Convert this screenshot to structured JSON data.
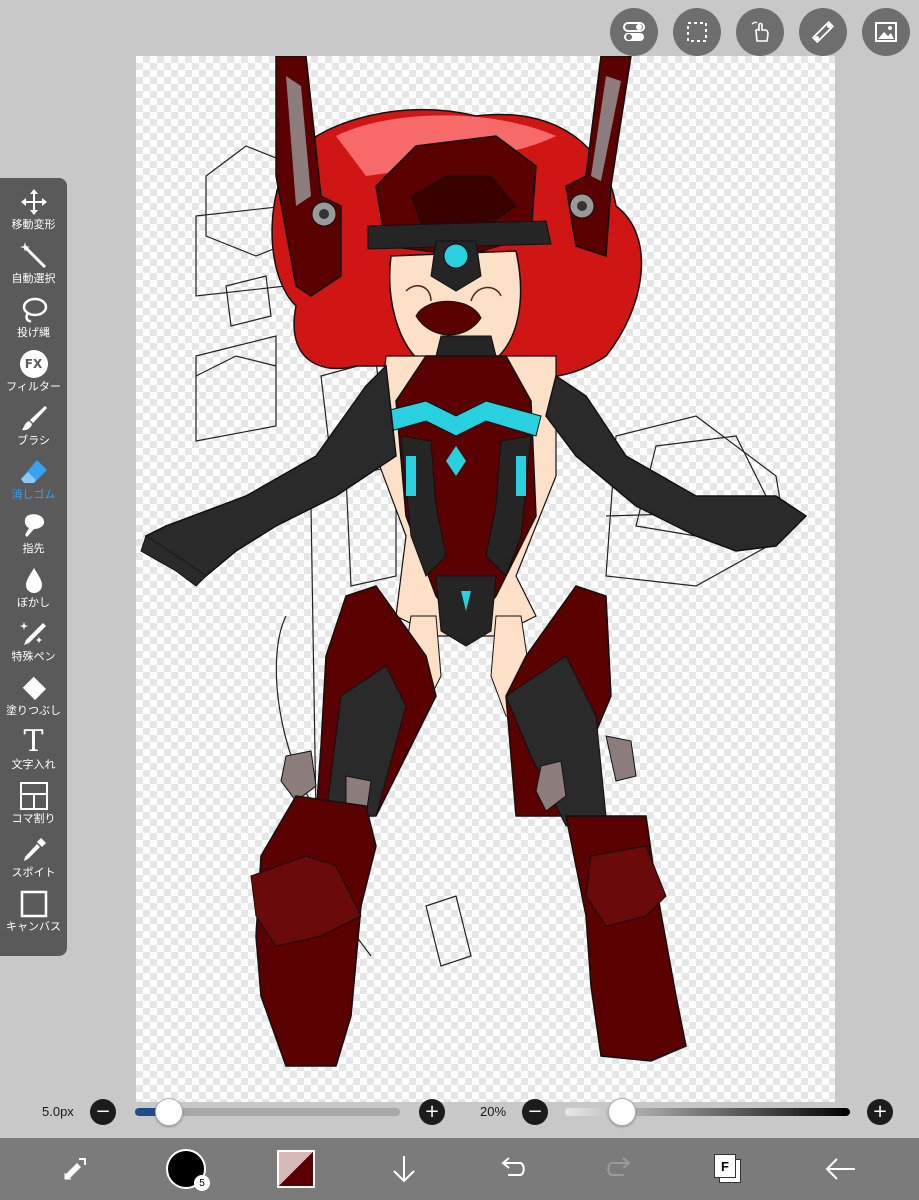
{
  "top_buttons": [
    {
      "name": "layer-toggle-icon"
    },
    {
      "name": "selection-icon"
    },
    {
      "name": "hand-touch-icon"
    },
    {
      "name": "ruler-icon"
    },
    {
      "name": "image-gallery-icon"
    }
  ],
  "tools": [
    {
      "label": "移動変形",
      "icon": "move-transform-icon"
    },
    {
      "label": "自動選択",
      "icon": "magic-wand-icon"
    },
    {
      "label": "投げ縄",
      "icon": "lasso-icon"
    },
    {
      "label": "フィルター",
      "icon": "fx-filter-icon",
      "glyph": "FX"
    },
    {
      "label": "ブラシ",
      "icon": "brush-icon"
    },
    {
      "label": "消しゴム",
      "icon": "eraser-icon"
    },
    {
      "label": "指先",
      "icon": "finger-smudge-icon"
    },
    {
      "label": "ぼかし",
      "icon": "blur-drop-icon"
    },
    {
      "label": "特殊ペン",
      "icon": "special-pen-icon"
    },
    {
      "label": "塗りつぶし",
      "icon": "bucket-fill-icon"
    },
    {
      "label": "文字入れ",
      "icon": "text-icon",
      "glyph": "T"
    },
    {
      "label": "コマ割り",
      "icon": "panel-frame-icon"
    },
    {
      "label": "スポイト",
      "icon": "eyedropper-icon"
    },
    {
      "label": "キャンバス",
      "icon": "canvas-icon"
    }
  ],
  "active_tool": "消しゴム",
  "brush_size": {
    "label": "5.0px",
    "value_fraction": 0.05,
    "minus": "−",
    "plus": "+"
  },
  "opacity": {
    "label": "20%",
    "value_fraction": 0.2,
    "minus": "−",
    "plus": "+"
  },
  "bottom_bar": {
    "color_badge": "5",
    "layer_badge": "F"
  },
  "colors": {
    "active_tool": "#3aa0f0",
    "brush_color": "#000000",
    "secondary_color": "#5a0000",
    "slider_fill": "#1f4e8c"
  }
}
